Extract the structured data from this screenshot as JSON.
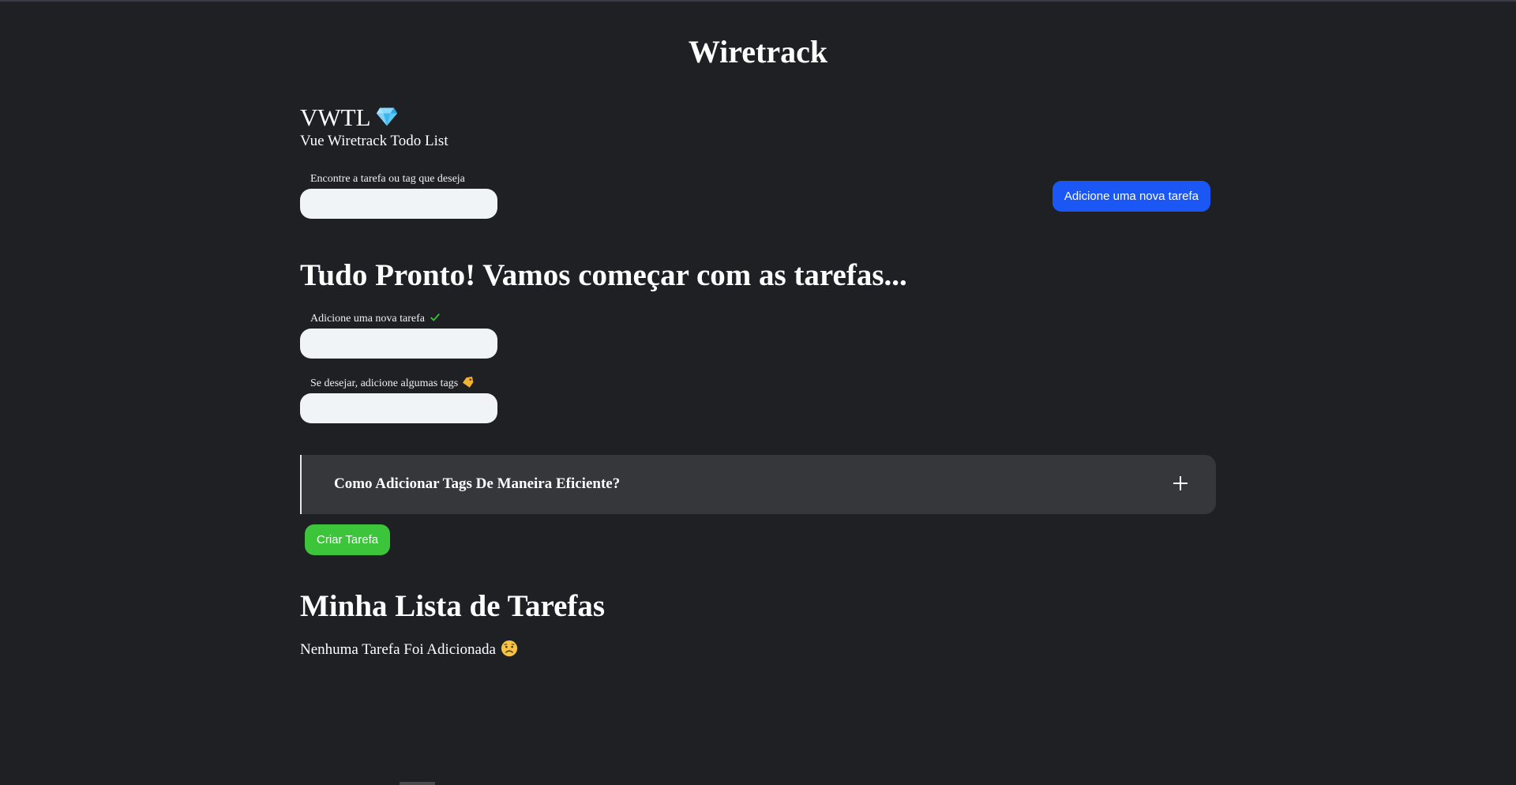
{
  "app": {
    "title": "Wiretrack"
  },
  "brand": {
    "name": "VWTL",
    "icon": "gem-icon",
    "subtitle": "Vue Wiretrack Todo List"
  },
  "search": {
    "label": "Encontre a tarefa ou tag que deseja",
    "value": "",
    "placeholder": ""
  },
  "header_button": {
    "label": "Adicione uma nova tarefa",
    "color": "#1a57f5"
  },
  "form": {
    "heading": "Tudo Pronto! Vamos começar com as tarefas...",
    "task_label": "Adicione uma nova tarefa",
    "task_icon": "check-icon",
    "task_value": "",
    "tags_label": "Se desejar, adicione algumas tags",
    "tags_icon": "tag-icon",
    "tags_value": ""
  },
  "accordion": {
    "title": "Como Adicionar Tags De Maneira Eficiente?",
    "icon": "plus-icon",
    "expanded": false
  },
  "create_button": {
    "label": "Criar Tarefa",
    "color": "#3cc43a"
  },
  "task_list": {
    "heading": "Minha Lista de Tarefas",
    "empty_message": "Nenhuma Tarefa Foi Adicionada",
    "empty_icon": "sad-face-icon",
    "items": []
  }
}
